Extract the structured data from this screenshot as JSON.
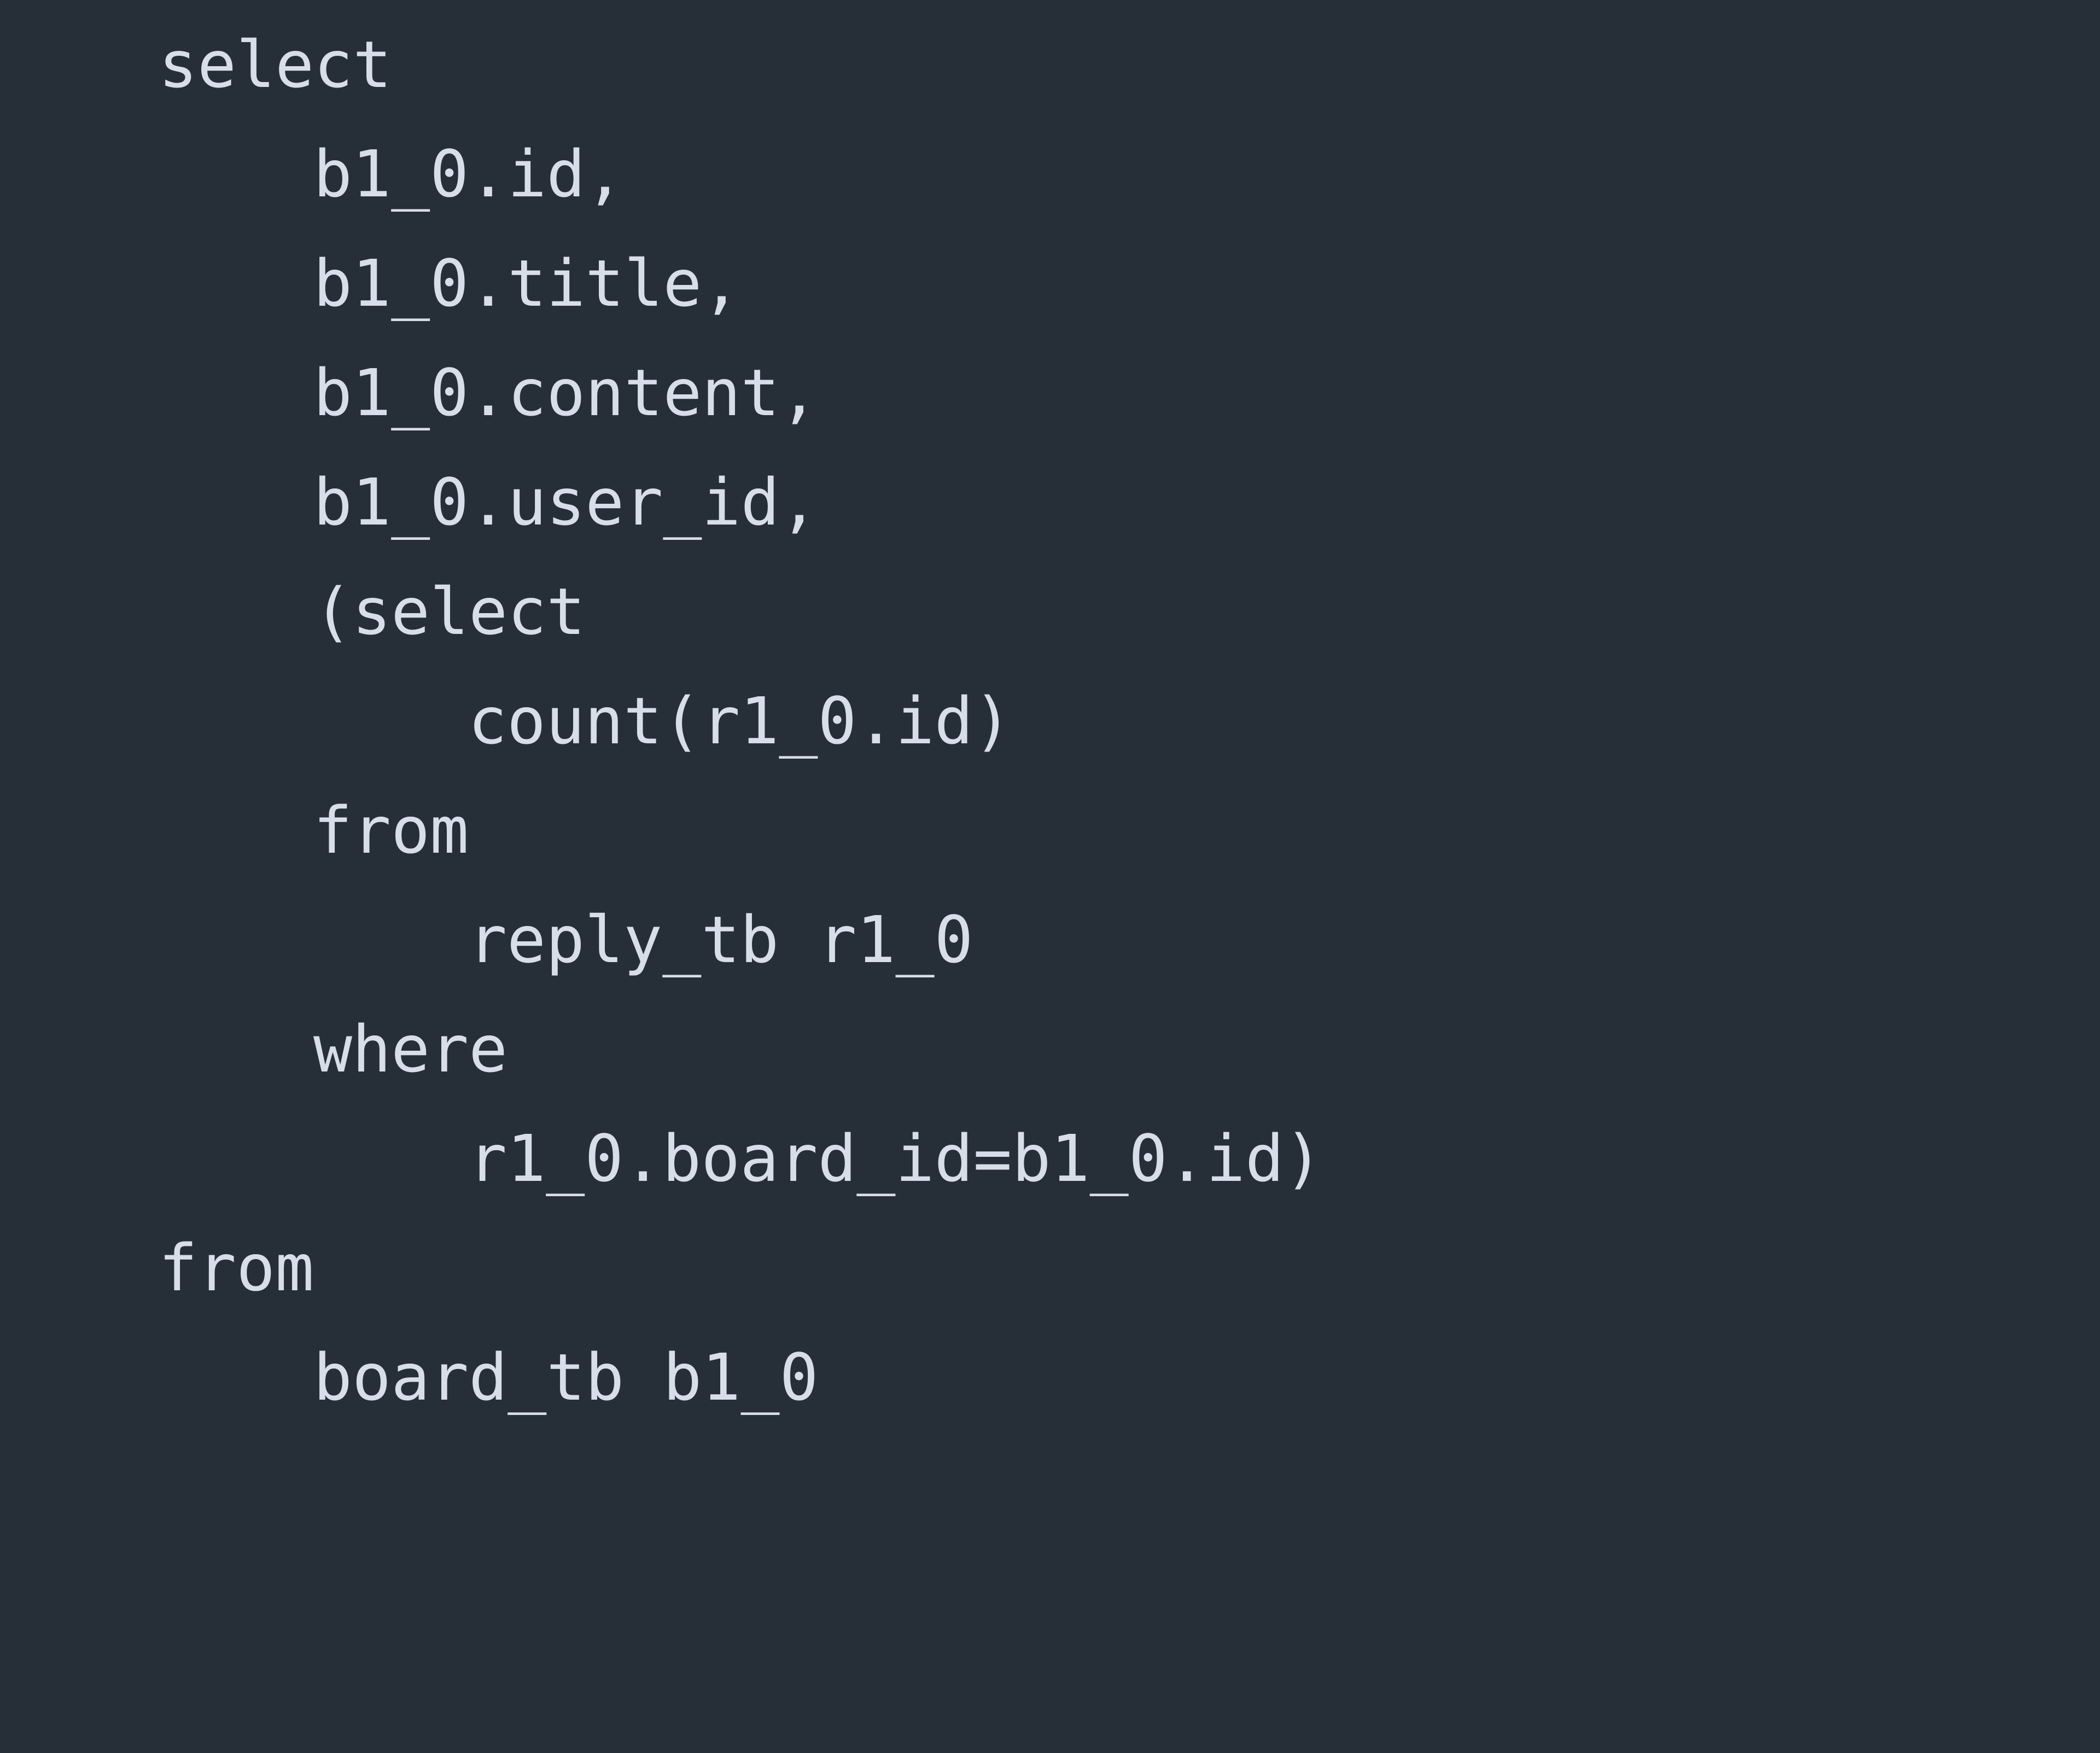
{
  "console": {
    "background_color": "#262f38",
    "text_color": "#d8dee9",
    "language": "sql",
    "lines": [
      {
        "indent": 0,
        "text": "select"
      },
      {
        "indent": 1,
        "text": "b1_0.id,"
      },
      {
        "indent": 1,
        "text": "b1_0.title,"
      },
      {
        "indent": 1,
        "text": "b1_0.content,"
      },
      {
        "indent": 1,
        "text": "b1_0.user_id,"
      },
      {
        "indent": 1,
        "text": "(select"
      },
      {
        "indent": 2,
        "text": "count(r1_0.id)"
      },
      {
        "indent": 1,
        "text": "from"
      },
      {
        "indent": 2,
        "text": "reply_tb r1_0"
      },
      {
        "indent": 1,
        "text": "where"
      },
      {
        "indent": 2,
        "text": "r1_0.board_id=b1_0.id)"
      },
      {
        "indent": 0,
        "text": "from"
      },
      {
        "indent": 1,
        "text": "board_tb b1_0"
      }
    ],
    "line_texts": {
      "l0": "select",
      "l1": "b1_0.id,",
      "l2": "b1_0.title,",
      "l3": "b1_0.content,",
      "l4": "b1_0.user_id,",
      "l5": "(select",
      "l6": "count(r1_0.id)",
      "l7": "from",
      "l8": "reply_tb r1_0",
      "l9": "where",
      "l10": "r1_0.board_id=b1_0.id)",
      "l11": "from",
      "l12": "board_tb b1_0"
    }
  }
}
